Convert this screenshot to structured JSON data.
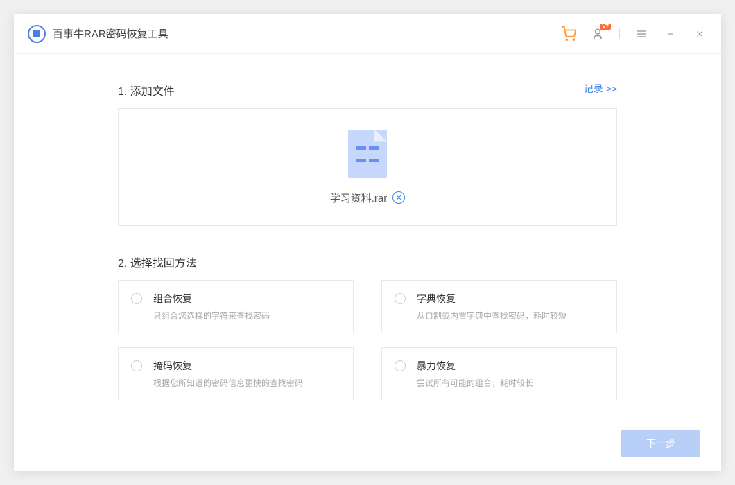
{
  "app": {
    "title": "百事牛RAR密码恢复工具"
  },
  "titlebar": {
    "vip_badge": "V7"
  },
  "section1": {
    "title": "1. 添加文件",
    "records_link": "记录 >>",
    "file_name": "学习资料.rar"
  },
  "section2": {
    "title": "2. 选择找回方法",
    "methods": [
      {
        "title": "组合恢复",
        "desc": "只组合您选择的字符来查找密码"
      },
      {
        "title": "字典恢复",
        "desc": "从自制或内置字典中查找密码，耗时较短"
      },
      {
        "title": "掩码恢复",
        "desc": "根据您所知道的密码信息更快的查找密码"
      },
      {
        "title": "暴力恢复",
        "desc": "尝试所有可能的组合，耗时较长"
      }
    ]
  },
  "footer": {
    "next": "下一步"
  }
}
